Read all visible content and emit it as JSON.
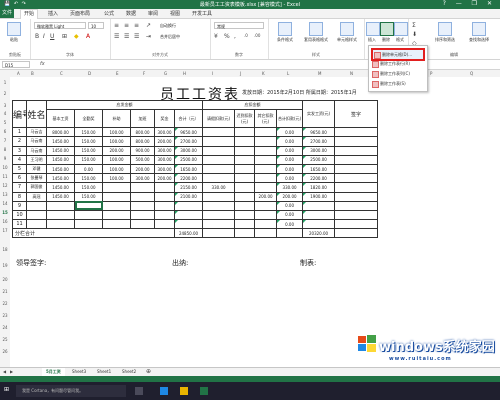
{
  "window": {
    "title": "最新员工工资表模板.xlsx [兼容模式] - Excel",
    "controls": [
      "?",
      "—",
      "❐",
      "✕"
    ]
  },
  "ribbon_tabs": [
    "文件",
    "开始",
    "插入",
    "页面布局",
    "公式",
    "数据",
    "审阅",
    "视图",
    "开发工具"
  ],
  "ribbon": {
    "font_name": "微软雅黑 Light",
    "font_size": "10",
    "number_format": "常规",
    "groups": [
      "剪贴板",
      "字体",
      "对齐方式",
      "数字",
      "样式",
      "单元格",
      "编辑"
    ],
    "buttons": [
      "粘贴",
      "条件格式",
      "套用表格格式",
      "单元格样式",
      "插入",
      "删除",
      "格式",
      "排序和筛选",
      "查找和选择"
    ],
    "wrap_text": "自动换行",
    "merge_center": "合并后居中"
  },
  "delete_menu": {
    "items": [
      "删除单元格(D)...",
      "删除工作表行(R)",
      "删除工作表列(C)",
      "删除工作表(S)"
    ],
    "highlighted": 0
  },
  "formula_bar": {
    "name_box": "D15",
    "fx": "fx",
    "value": ""
  },
  "columns": [
    "A",
    "B",
    "C",
    "D",
    "E",
    "F",
    "G",
    "H",
    "I",
    "J",
    "K",
    "L",
    "M",
    "N",
    "O",
    "P",
    "Q"
  ],
  "rows": [
    "1",
    "2",
    "3",
    "4",
    "5",
    "6",
    "7",
    "8",
    "9",
    "10",
    "11",
    "12",
    "13",
    "14",
    "15",
    "16",
    "17",
    "18",
    "19",
    "20",
    "21",
    "22",
    "23",
    "24",
    "25",
    "26"
  ],
  "sheet": {
    "title": "员工工资表",
    "meta": "发放日期：2015年2月10日 所属日期：2015年1月",
    "header_top": {
      "id": "编号",
      "name": "姓名",
      "payable": "应发金额",
      "deduct": "应扣金额",
      "actual": "实发工资(元)",
      "sign": "签字"
    },
    "header_sub": [
      "基本工资",
      "全勤奖",
      "补助",
      "加班",
      "奖金",
      "合计（元）",
      "请假扣款(元)",
      "迟到扣款(元)",
      "其它扣款(元)",
      "合计扣款(元)"
    ],
    "employees": [
      [
        "1",
        "马云吉",
        "8000.00",
        "150.00",
        "100.00",
        "800.00",
        "300.00",
        "9650.00",
        "",
        "",
        "",
        "0.00",
        "9650.00"
      ],
      [
        "2",
        "马云南",
        "1450.00",
        "150.00",
        "100.00",
        "800.00",
        "200.00",
        "2700.00",
        "",
        "",
        "",
        "0.00",
        "2700.00"
      ],
      [
        "3",
        "马云南",
        "1450.00",
        "150.00",
        "200.00",
        "900.00",
        "300.00",
        "3000.00",
        "",
        "",
        "",
        "0.00",
        "3000.00"
      ],
      [
        "4",
        "王习明",
        "1450.00",
        "150.00",
        "100.00",
        "500.00",
        "300.00",
        "2500.00",
        "",
        "",
        "",
        "0.00",
        "2500.00"
      ],
      [
        "5",
        "邓健",
        "1450.00",
        "0.00",
        "100.00",
        "200.00",
        "300.00",
        "1650.00",
        "",
        "",
        "",
        "0.00",
        "1650.00"
      ],
      [
        "6",
        "张曼琴",
        "1450.00",
        "150.00",
        "100.00",
        "300.00",
        "200.00",
        "2200.00",
        "",
        "",
        "",
        "0.00",
        "2200.00"
      ],
      [
        "7",
        "郭国俊",
        "1450.00",
        "150.00",
        "",
        "",
        "",
        "2150.00",
        "330.00",
        "",
        "",
        "330.00",
        "1820.00"
      ],
      [
        "8",
        "高冠",
        "1450.00",
        "150.00",
        "",
        "",
        "",
        "2100.00",
        "",
        "",
        "200.00",
        "200.00",
        "1900.00"
      ],
      [
        "9",
        "",
        "",
        "",
        "",
        "",
        "",
        "",
        "",
        "",
        "",
        "0.00",
        ""
      ],
      [
        "10",
        "",
        "",
        "",
        "",
        "",
        "",
        "",
        "",
        "",
        "",
        "0.00",
        ""
      ],
      [
        "11",
        "",
        "",
        "",
        "",
        "",
        "",
        "",
        "",
        "",
        "",
        "0.00",
        ""
      ]
    ],
    "subtotal_label": "分栏合计",
    "subtotal_total": "24850.00",
    "subtotal_actual": "20320.00",
    "footer": {
      "leader": "领导签字:",
      "cashier": "出纳:",
      "preparer": "制表:"
    }
  },
  "sheet_tabs": [
    "5月工资",
    "Sheet3",
    "Sheet1",
    "Sheet2"
  ],
  "active_sheet": 0,
  "taskbar": {
    "search": "我是 Cortana，有问题尽管问我。"
  },
  "watermark": {
    "brand": "windows系统家园",
    "site": "www.ruitaiu.com"
  }
}
